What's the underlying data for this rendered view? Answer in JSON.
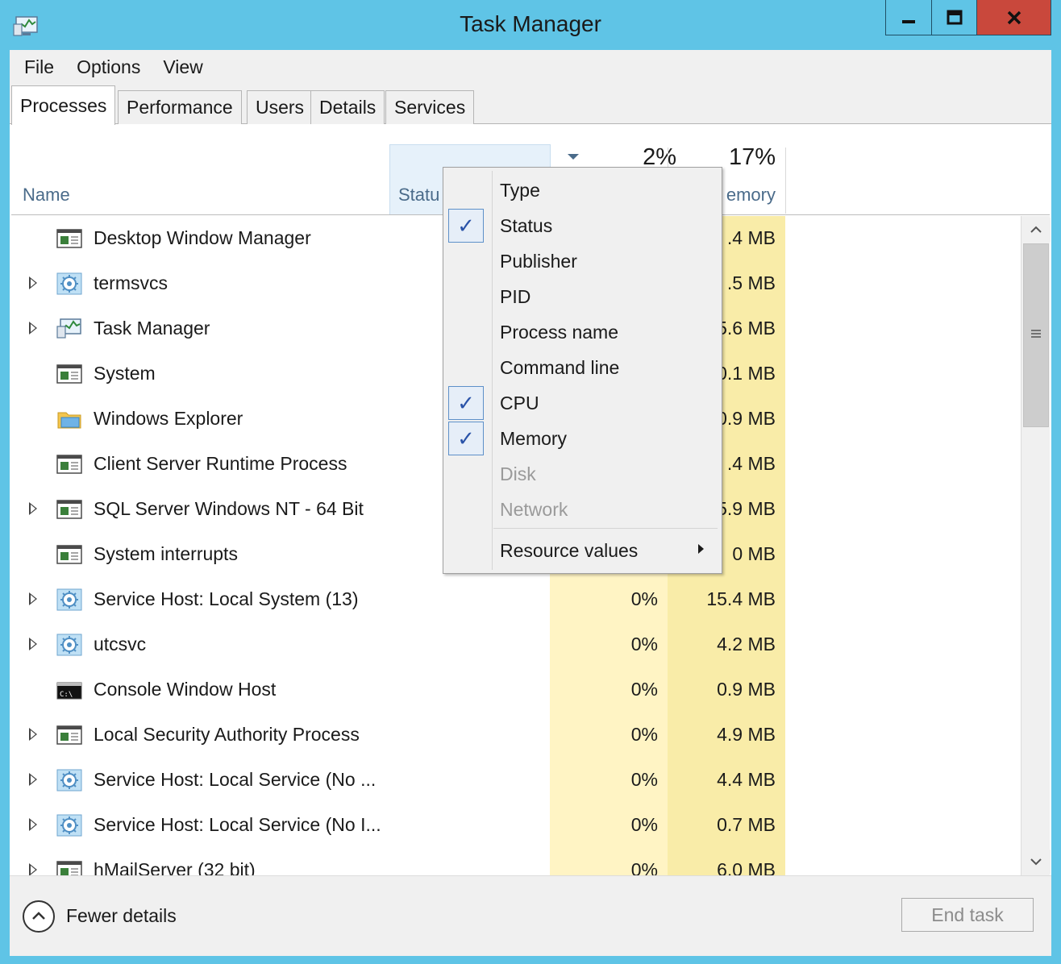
{
  "window": {
    "title": "Task Manager"
  },
  "menu": [
    "File",
    "Options",
    "View"
  ],
  "tabs": [
    "Processes",
    "Performance",
    "Users",
    "Details",
    "Services"
  ],
  "header": {
    "name": "Name",
    "status": "Statu",
    "cpu_percent": "2%",
    "memory_percent": "17%",
    "memory": "emory"
  },
  "processes": [
    {
      "name": "Desktop Window Manager",
      "icon": "app-window-icon",
      "expand": false,
      "cpu": "",
      "memory": ".4 MB"
    },
    {
      "name": "termsvcs",
      "icon": "service-gear-icon",
      "expand": true,
      "cpu": "",
      "memory": ".5 MB"
    },
    {
      "name": "Task Manager",
      "icon": "task-manager-icon",
      "expand": true,
      "cpu": "",
      "memory": "5.6 MB"
    },
    {
      "name": "System",
      "icon": "app-window-icon",
      "expand": false,
      "cpu": "",
      "memory": "0.1 MB"
    },
    {
      "name": "Windows Explorer",
      "icon": "folder-icon",
      "expand": false,
      "cpu": "",
      "memory": "0.9 MB"
    },
    {
      "name": "Client Server Runtime Process",
      "icon": "app-window-icon",
      "expand": false,
      "cpu": "",
      "memory": ".4 MB"
    },
    {
      "name": "SQL Server Windows NT - 64 Bit",
      "icon": "app-window-icon",
      "expand": true,
      "cpu": "",
      "memory": "5.9 MB"
    },
    {
      "name": "System interrupts",
      "icon": "app-window-icon",
      "expand": false,
      "cpu": "",
      "memory": "0 MB"
    },
    {
      "name": "Service Host: Local System (13)",
      "icon": "service-gear-icon",
      "expand": true,
      "cpu": "0%",
      "memory": "15.4 MB"
    },
    {
      "name": "utcsvc",
      "icon": "service-gear-icon",
      "expand": true,
      "cpu": "0%",
      "memory": "4.2 MB"
    },
    {
      "name": "Console Window Host",
      "icon": "console-icon",
      "expand": false,
      "cpu": "0%",
      "memory": "0.9 MB"
    },
    {
      "name": "Local Security Authority Process",
      "icon": "app-window-icon",
      "expand": true,
      "cpu": "0%",
      "memory": "4.9 MB"
    },
    {
      "name": "Service Host: Local Service (No ...",
      "icon": "service-gear-icon",
      "expand": true,
      "cpu": "0%",
      "memory": "4.4 MB"
    },
    {
      "name": "Service Host: Local Service (No I...",
      "icon": "service-gear-icon",
      "expand": true,
      "cpu": "0%",
      "memory": "0.7 MB"
    },
    {
      "name": "hMailServer (32 bit)",
      "icon": "app-window-icon",
      "expand": true,
      "cpu": "0%",
      "memory": "6.0 MB"
    }
  ],
  "context_menu": {
    "items": [
      {
        "label": "Type",
        "checked": false,
        "disabled": false
      },
      {
        "label": "Status",
        "checked": true,
        "disabled": false
      },
      {
        "label": "Publisher",
        "checked": false,
        "disabled": false
      },
      {
        "label": "PID",
        "checked": false,
        "disabled": false
      },
      {
        "label": "Process name",
        "checked": false,
        "disabled": false
      },
      {
        "label": "Command line",
        "checked": false,
        "disabled": false
      },
      {
        "label": "CPU",
        "checked": true,
        "disabled": false
      },
      {
        "label": "Memory",
        "checked": true,
        "disabled": false
      },
      {
        "label": "Disk",
        "checked": false,
        "disabled": true
      },
      {
        "label": "Network",
        "checked": false,
        "disabled": true
      }
    ],
    "submenu_label": "Resource values",
    "check_glyph": "✓"
  },
  "footer": {
    "fewer_details": "Fewer details",
    "end_task": "End task"
  },
  "colors": {
    "titlebar": "#5fc4e6",
    "close_button": "#c9483c",
    "cpu_column": "#fff4c4",
    "memory_column": "#f9eca8"
  }
}
